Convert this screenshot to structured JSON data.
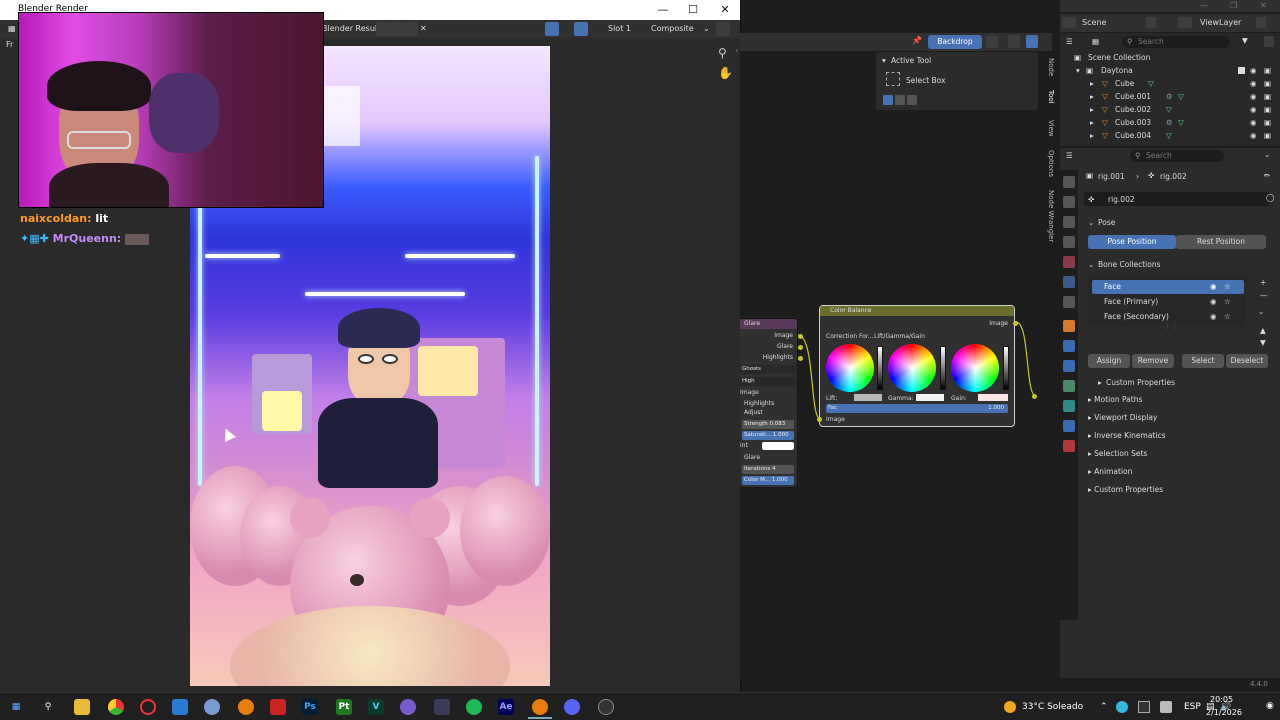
{
  "render_window": {
    "title": "Blender Render",
    "menu_fragment": "Fr",
    "image_name": "Blender Result",
    "slot": "Slot 1",
    "layer": "Composite"
  },
  "chat": {
    "line1_user": "naixcoldan:",
    "line1_text": "lit",
    "line2_user": "MrQueenn:",
    "line2_user_color": "#c58af9",
    "line1_user_color": "#ff9a1f"
  },
  "node_editor": {
    "backdrop_label": "Backdrop",
    "active_tool_title": "Active Tool",
    "active_tool_item": "Select Box",
    "tabs": [
      "Node",
      "Tool",
      "View",
      "Options",
      "Node Wrangler"
    ],
    "glare_node": {
      "title": "Glare",
      "out_image": "Image",
      "out_glare": "Glare",
      "out_highlights": "Highlights",
      "type": "Ghosts",
      "quality": "High",
      "in_image": "Image",
      "highlights_label": "Highlights",
      "adjust_label": "Adjust",
      "strength": "Strength",
      "strength_val": "0.083",
      "saturation": "Saturati...",
      "saturation_val": "1.000",
      "tint": "int",
      "glare_label": "Glare",
      "iterations": "Iterations",
      "iterations_val": "4",
      "color_mod": "Color M...",
      "color_mod_val": "1.000"
    },
    "color_balance_node": {
      "title": "Color Balance",
      "out_image": "Image",
      "correction": "Correction For...",
      "mode": "Lift/Gamma/Gain",
      "lift": "Lift:",
      "gamma": "Gamma:",
      "gain": "Gain:",
      "fac": "Fac",
      "fac_val": "1.000",
      "in_image": "Image"
    }
  },
  "scene_bar": {
    "scene": "Scene",
    "view_layer": "ViewLayer"
  },
  "outliner": {
    "search_placeholder": "Search",
    "root": "Scene Collection",
    "collection": "Daytona",
    "items": [
      "Cube",
      "Cube.001",
      "Cube.002",
      "Cube.003",
      "Cube.004"
    ]
  },
  "properties": {
    "search_placeholder": "Search",
    "breadcrumb_a": "rig.001",
    "breadcrumb_b": "rig.002",
    "object_name": "rig.002",
    "pose_label": "Pose",
    "pose_position": "Pose Position",
    "rest_position": "Rest Position",
    "bone_collections": "Bone Collections",
    "collections": [
      "Face",
      "Face (Primary)",
      "Face (Secondary)"
    ],
    "assign": "Assign",
    "remove": "Remove",
    "select": "Select",
    "deselect": "Deselect",
    "custom_props_inner": "Custom Properties",
    "panels": [
      "Motion Paths",
      "Viewport Display",
      "Inverse Kinematics",
      "Selection Sets",
      "Animation",
      "Custom Properties"
    ],
    "version": "4.4.0"
  },
  "taskbar": {
    "weather": "33°C  Soleado",
    "lang": "ESP",
    "time": "20:05",
    "date": "2/1/2026",
    "apps": [
      "Ps",
      "Pt",
      "V",
      "Ae"
    ]
  }
}
